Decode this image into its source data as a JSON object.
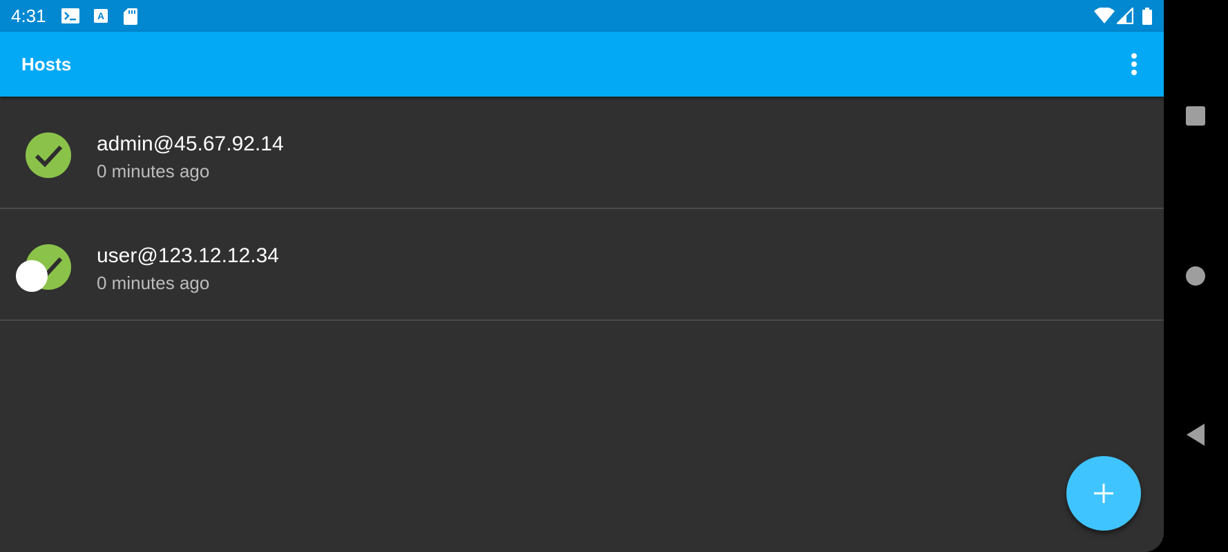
{
  "status_bar": {
    "time": "4:31",
    "notification_icons": [
      "terminal-icon",
      "font-a-icon",
      "sd-card-icon"
    ],
    "system_icons": [
      "wifi-icon",
      "cellular-signal-icon",
      "battery-icon"
    ]
  },
  "app_bar": {
    "title": "Hosts",
    "overflow_icon": "more-vert-icon"
  },
  "hosts": [
    {
      "name": "admin@45.67.92.14",
      "last_connected": "0 minutes ago",
      "status": "connected",
      "status_icon": "check-circle-icon"
    },
    {
      "name": "user@123.12.12.34",
      "last_connected": "0 minutes ago",
      "status": "connected",
      "status_icon": "check-circle-icon"
    }
  ],
  "fab": {
    "icon": "plus-icon"
  },
  "nav_bar": {
    "buttons": [
      "recents-square-icon",
      "home-circle-icon",
      "back-triangle-icon"
    ]
  },
  "colors": {
    "status_bar": "#0288d1",
    "app_bar": "#03a9f4",
    "background": "#303030",
    "connected_green": "#8bc34a",
    "fab": "#40c4ff",
    "divider": "#4a4a4a"
  }
}
